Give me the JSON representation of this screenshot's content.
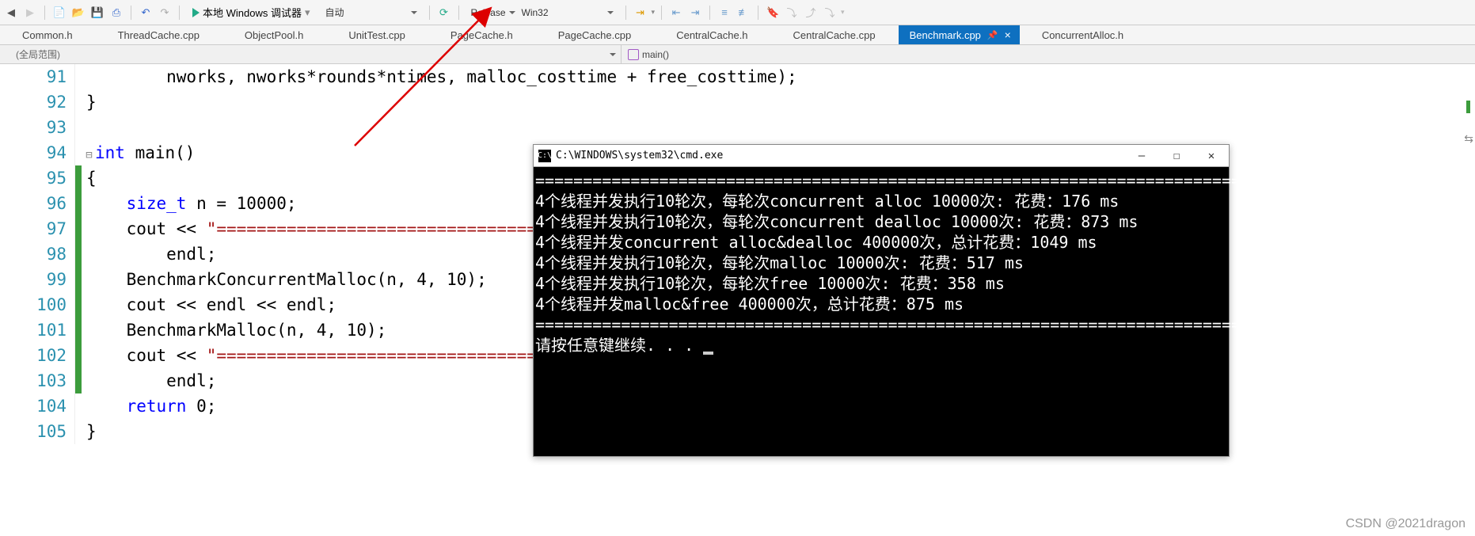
{
  "toolbar": {
    "debugger_label": "本地 Windows 调试器",
    "config_auto": "自动",
    "build_config": "Release",
    "platform": "Win32"
  },
  "tabs": [
    {
      "label": "Common.h",
      "active": false
    },
    {
      "label": "ThreadCache.cpp",
      "active": false
    },
    {
      "label": "ObjectPool.h",
      "active": false
    },
    {
      "label": "UnitTest.cpp",
      "active": false
    },
    {
      "label": "PageCache.h",
      "active": false
    },
    {
      "label": "PageCache.cpp",
      "active": false
    },
    {
      "label": "CentralCache.h",
      "active": false
    },
    {
      "label": "CentralCache.cpp",
      "active": false
    },
    {
      "label": "Benchmark.cpp",
      "active": true
    },
    {
      "label": "ConcurrentAlloc.h",
      "active": false
    }
  ],
  "scope": {
    "left": "(全局范围)",
    "right": "main()"
  },
  "code": {
    "lines": [
      {
        "num": 91,
        "marker": false,
        "text_parts": [
          {
            "t": "        nworks, nworks*rounds*ntimes, malloc_costtime + free_costtime);",
            "c": "ident"
          }
        ]
      },
      {
        "num": 92,
        "marker": false,
        "text_parts": [
          {
            "t": "}",
            "c": "ident"
          }
        ]
      },
      {
        "num": 93,
        "marker": false,
        "text_parts": []
      },
      {
        "num": 94,
        "marker": false,
        "collapse": true,
        "text_parts": [
          {
            "t": "int",
            "c": "kw"
          },
          {
            "t": " main()",
            "c": "ident"
          }
        ]
      },
      {
        "num": 95,
        "marker": true,
        "text_parts": [
          {
            "t": "{",
            "c": "ident"
          }
        ]
      },
      {
        "num": 96,
        "marker": true,
        "text_parts": [
          {
            "t": "    ",
            "c": "ident"
          },
          {
            "t": "size_t",
            "c": "kw"
          },
          {
            "t": " n = 10000;",
            "c": "ident"
          }
        ]
      },
      {
        "num": 97,
        "marker": true,
        "text_parts": [
          {
            "t": "    cout << ",
            "c": "ident"
          },
          {
            "t": "\"==========================================",
            "c": "str"
          }
        ]
      },
      {
        "num": 98,
        "marker": true,
        "text_parts": [
          {
            "t": "        endl;",
            "c": "ident"
          }
        ]
      },
      {
        "num": 99,
        "marker": true,
        "text_parts": [
          {
            "t": "    BenchmarkConcurrentMalloc(n, 4, 10);",
            "c": "ident"
          }
        ]
      },
      {
        "num": 100,
        "marker": true,
        "text_parts": [
          {
            "t": "    cout << endl << endl;",
            "c": "ident"
          }
        ]
      },
      {
        "num": 101,
        "marker": true,
        "text_parts": [
          {
            "t": "    BenchmarkMalloc(n, 4, 10);",
            "c": "ident"
          }
        ]
      },
      {
        "num": 102,
        "marker": true,
        "text_parts": [
          {
            "t": "    cout << ",
            "c": "ident"
          },
          {
            "t": "\"==========================================",
            "c": "str"
          }
        ]
      },
      {
        "num": 103,
        "marker": true,
        "text_parts": [
          {
            "t": "        endl;",
            "c": "ident"
          }
        ]
      },
      {
        "num": 104,
        "marker": false,
        "text_parts": [
          {
            "t": "    ",
            "c": "ident"
          },
          {
            "t": "return",
            "c": "kw"
          },
          {
            "t": " 0;",
            "c": "ident"
          }
        ]
      },
      {
        "num": 105,
        "marker": false,
        "text_parts": [
          {
            "t": "}",
            "c": "ident"
          }
        ]
      }
    ]
  },
  "console": {
    "title": "C:\\WINDOWS\\system32\\cmd.exe",
    "lines": [
      "==========================================================================",
      "4个线程并发执行10轮次，每轮次concurrent alloc 10000次: 花费：176 ms",
      "4个线程并发执行10轮次，每轮次concurrent dealloc 10000次: 花费：873 ms",
      "4个线程并发concurrent alloc&dealloc 400000次，总计花费：1049 ms",
      "",
      "",
      "4个线程并发执行10轮次，每轮次malloc 10000次: 花费：517 ms",
      "4个线程并发执行10轮次，每轮次free 10000次: 花费：358 ms",
      "4个线程并发malloc&free 400000次，总计花费：875 ms",
      "==========================================================================",
      "请按任意键继续. . . "
    ]
  },
  "watermark": "CSDN @2021dragon"
}
